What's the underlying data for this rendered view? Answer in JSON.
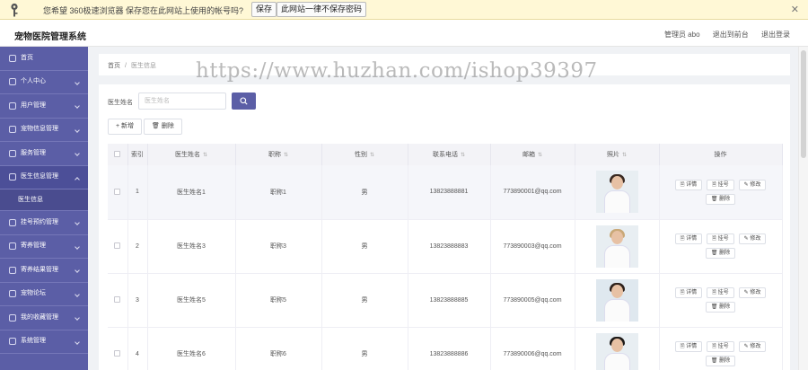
{
  "password_bar": {
    "message": "您希望 360极速浏览器 保存您在此网站上使用的帐号吗?",
    "save_label": "保存",
    "never_label": "此网站一律不保存密码",
    "close_label": "✕"
  },
  "header": {
    "title": "宠物医院管理系统",
    "user_label": "管理员 abo",
    "back_label": "退出到前台",
    "logout_label": "退出登录"
  },
  "sidebar": {
    "items": [
      {
        "label": "首页"
      },
      {
        "label": "个人中心"
      },
      {
        "label": "用户管理"
      },
      {
        "label": "宠物信息管理"
      },
      {
        "label": "服务管理"
      },
      {
        "label": "医生信息管理"
      },
      {
        "label": "挂号预约管理"
      },
      {
        "label": "寄养管理"
      },
      {
        "label": "寄养结果管理"
      },
      {
        "label": "宠物论坛"
      },
      {
        "label": "我的收藏管理"
      },
      {
        "label": "系统管理"
      }
    ],
    "sub_item": "医生信息"
  },
  "breadcrumb": {
    "home": "首页",
    "separator": "/",
    "current": "医生信息"
  },
  "watermark": "https://www.huzhan.com/ishop39397",
  "search": {
    "label": "医生姓名",
    "placeholder": "医生姓名"
  },
  "toolbar": {
    "add_label": "+ 新增",
    "delete_label": "删除"
  },
  "table": {
    "headers": [
      "索引",
      "医生姓名",
      "职称",
      "性别",
      "联系电话",
      "邮箱",
      "照片",
      "操作"
    ],
    "rows": [
      {
        "index": "1",
        "name": "医生姓名1",
        "title": "职称1",
        "gender": "男",
        "phone": "13823888881",
        "email": "773890001@qq.com"
      },
      {
        "index": "2",
        "name": "医生姓名3",
        "title": "职称3",
        "gender": "男",
        "phone": "13823888883",
        "email": "773890003@qq.com"
      },
      {
        "index": "3",
        "name": "医生姓名5",
        "title": "职称5",
        "gender": "男",
        "phone": "13823888885",
        "email": "773890005@qq.com"
      },
      {
        "index": "4",
        "name": "医生姓名6",
        "title": "职称6",
        "gender": "男",
        "phone": "13823888886",
        "email": "773890006@qq.com"
      }
    ],
    "actions": {
      "detail": "详情",
      "register": "挂号",
      "edit": "修改",
      "delete": "删除"
    }
  }
}
